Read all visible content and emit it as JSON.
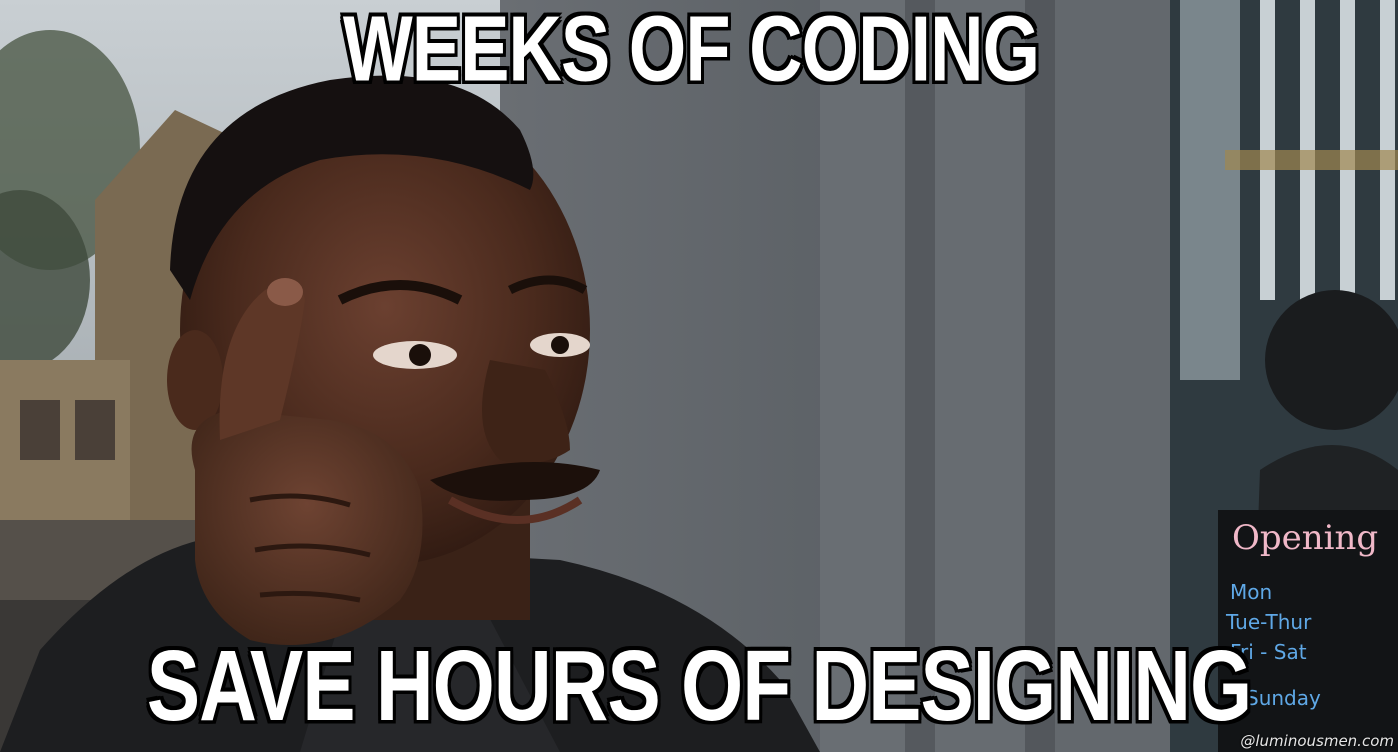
{
  "meme": {
    "top_text": "WEEKS OF CODING",
    "bottom_text": "SAVE HOURS OF DESIGNING",
    "sign": {
      "title": "Opening",
      "lines": [
        "Mon",
        "Tue-Thur",
        "Fri - Sat",
        "Sunday"
      ]
    },
    "watermark": "@luminousmen.com"
  },
  "colors": {
    "wall": "#5f646a",
    "skin": "#4a2c1f",
    "jacket": "#1d1e20",
    "sign_text": "#5fa8e6",
    "sign_title": "#f0b8c8"
  }
}
